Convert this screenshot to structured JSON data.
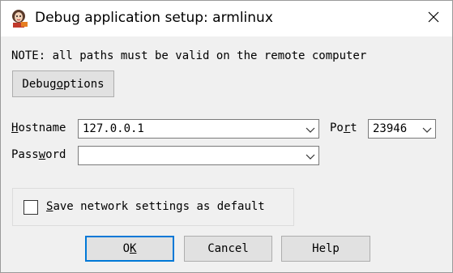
{
  "window": {
    "title": "Debug application setup: armlinux",
    "close_glyph": "✕"
  },
  "note": "NOTE: all paths must be valid on the remote computer",
  "debug_options": {
    "pre": "Debug ",
    "accel": "o",
    "post": "ptions"
  },
  "hostname": {
    "label_accel": "H",
    "label_rest": "ostname",
    "value": "127.0.0.1"
  },
  "port": {
    "label_pre": "Po",
    "label_accel": "r",
    "label_post": "t",
    "value": "23946"
  },
  "password": {
    "label_pre": "Pass",
    "label_accel": "w",
    "label_post": "ord",
    "value": ""
  },
  "save_settings": {
    "checked": false,
    "label_accel": "S",
    "label_rest": "ave network settings as default"
  },
  "buttons": {
    "ok": {
      "pre": "O",
      "accel": "K"
    },
    "cancel": "Cancel",
    "help": "Help"
  },
  "colors": {
    "focus_border": "#0078d7",
    "background": "#f0f0f0"
  },
  "icons": {
    "app": "ida-icon",
    "close": "close-icon",
    "dropdown": "chevron-down-icon"
  }
}
